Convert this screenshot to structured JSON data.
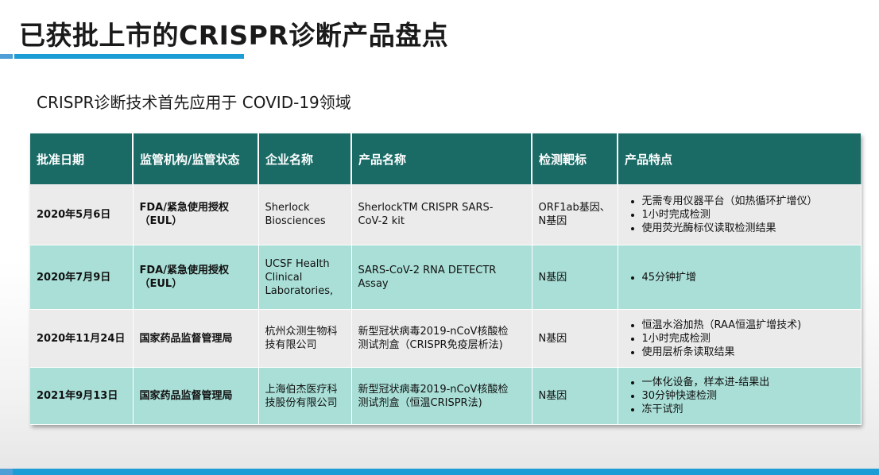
{
  "header": {
    "title": "已获批上市的CRISPR诊断产品盘点",
    "subtitle": "CRISPR诊断技术首先应用于 COVID-19领域"
  },
  "colors": {
    "header_bg": "#1a6b66",
    "row_light": "#ebebeb",
    "row_teal": "#a9dfd7",
    "accent_blue": "#1d9dd6"
  },
  "table": {
    "columns": [
      "批准日期",
      "监管机构/监管状态",
      "企业名称",
      "产品名称",
      "检测靶标",
      "产品特点"
    ],
    "rows": [
      {
        "date": "2020年5月6日",
        "agency": [
          "FDA/紧急使用授权",
          "（EUL）"
        ],
        "company": [
          "Sherlock",
          "Biosciences"
        ],
        "product": [
          "SherlockTM CRISPR SARS-",
          "CoV-2 kit"
        ],
        "target": [
          "ORF1ab基因、",
          "N基因"
        ],
        "features": [
          "无需专用仪器平台（如热循环扩增仪）",
          "1小时完成检测",
          "使用荧光酶标仪读取检测结果"
        ]
      },
      {
        "date": "2020年7月9日",
        "agency": [
          "FDA/紧急使用授权",
          "（EUL）"
        ],
        "company": [
          "UCSF Health",
          "Clinical",
          "Laboratories,"
        ],
        "product": [
          "SARS-CoV-2 RNA DETECTR",
          "Assay"
        ],
        "target": [
          "N基因"
        ],
        "features": [
          "45分钟扩增"
        ]
      },
      {
        "date": "2020年11月24日",
        "agency": [
          "国家药品监督管理局"
        ],
        "company": [
          "杭州众测生物科",
          "技有限公司"
        ],
        "product": [
          "新型冠状病毒2019-nCoV核酸检",
          "测试剂盒（CRISPR免疫层析法)"
        ],
        "target": [
          "N基因"
        ],
        "features": [
          "恒温水浴加热（RAA恒温扩增技术)",
          "1小时完成检测",
          "使用层析条读取结果"
        ]
      },
      {
        "date": "2021年9月13日",
        "agency": [
          "国家药品监督管理局"
        ],
        "company": [
          "上海伯杰医疗科",
          "技股份有限公司"
        ],
        "product": [
          "新型冠状病毒2019-nCoV核酸检",
          "测试剂盒（恒温CRISPR法)"
        ],
        "target": [
          "N基因"
        ],
        "features": [
          "一体化设备，样本进-结果出",
          "30分钟快速检测",
          "冻干试剂"
        ]
      }
    ]
  }
}
